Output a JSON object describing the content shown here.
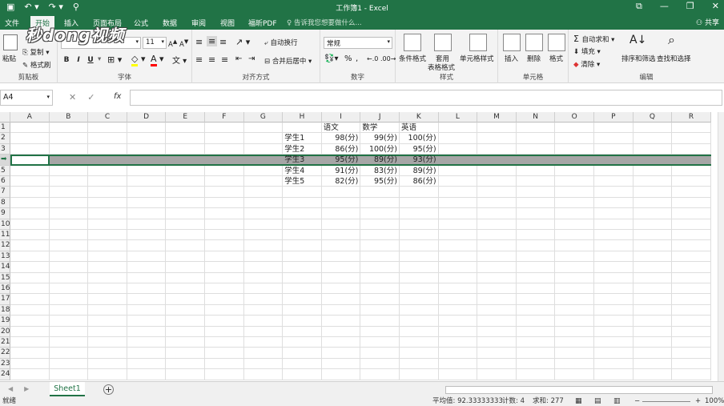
{
  "window": {
    "title": "工作簿1 - Excel"
  },
  "tabs": [
    "文件",
    "开始",
    "插入",
    "页面布局",
    "公式",
    "数据",
    "审阅",
    "视图",
    "福昕PDF"
  ],
  "active_tab": "开始",
  "search_placeholder": "告诉我您想要做什么...",
  "share_label": "共享",
  "watermark": "秒dong视频",
  "ribbon": {
    "clipboard": {
      "label": "剪贴板",
      "paste": "粘贴",
      "copy": "复制",
      "format_painter": "格式刷"
    },
    "font": {
      "label": "字体",
      "size": "11",
      "bold": "B",
      "italic": "I",
      "underline": "U"
    },
    "alignment": {
      "label": "对齐方式",
      "wrap_text": "自动换行",
      "merge_center": "合并后居中"
    },
    "number": {
      "label": "数字",
      "format": "常规"
    },
    "styles": {
      "label": "样式",
      "conditional": "条件格式",
      "table_line1": "套用",
      "table_line2": "表格格式",
      "cell_styles": "单元格样式"
    },
    "cells": {
      "label": "单元格",
      "insert": "插入",
      "delete": "删除",
      "format": "格式"
    },
    "editing": {
      "label": "编辑",
      "autosum": "自动求和",
      "fill": "填充",
      "clear": "清除",
      "sort_filter": "排序和筛选",
      "find_select": "查找和选择"
    }
  },
  "formula_bar": {
    "name_box": "A4",
    "fx": "fx",
    "formula": ""
  },
  "columns": [
    "A",
    "B",
    "C",
    "D",
    "E",
    "F",
    "G",
    "H",
    "I",
    "J",
    "K",
    "L",
    "M",
    "N",
    "O",
    "P",
    "Q",
    "R"
  ],
  "rows": [
    "1",
    "2",
    "3",
    "4",
    "5",
    "6",
    "7",
    "8",
    "9",
    "10",
    "11",
    "12",
    "13",
    "14",
    "15",
    "16",
    "17",
    "18",
    "19",
    "20",
    "21",
    "22",
    "23",
    "24"
  ],
  "table": {
    "headers": [
      "语文",
      "数学",
      "英语"
    ],
    "rows": [
      {
        "name": "学生1",
        "values": [
          "98(分)",
          "99(分)",
          "100(分)"
        ]
      },
      {
        "name": "学生2",
        "values": [
          "86(分)",
          "100(分)",
          "95(分)"
        ]
      },
      {
        "name": "学生3",
        "values": [
          "95(分)",
          "89(分)",
          "93(分)"
        ]
      },
      {
        "name": "学生4",
        "values": [
          "91(分)",
          "83(分)",
          "89(分)"
        ]
      },
      {
        "name": "学生5",
        "values": [
          "82(分)",
          "95(分)",
          "86(分)"
        ]
      }
    ]
  },
  "sheets": [
    "Sheet1"
  ],
  "status": {
    "ready": "就绪",
    "average": "平均值: 92.33333333",
    "count": "计数: 4",
    "sum": "求和: 277",
    "zoom": "100%"
  },
  "colors": {
    "brand": "#217346",
    "selection": "#a6a6a6"
  }
}
